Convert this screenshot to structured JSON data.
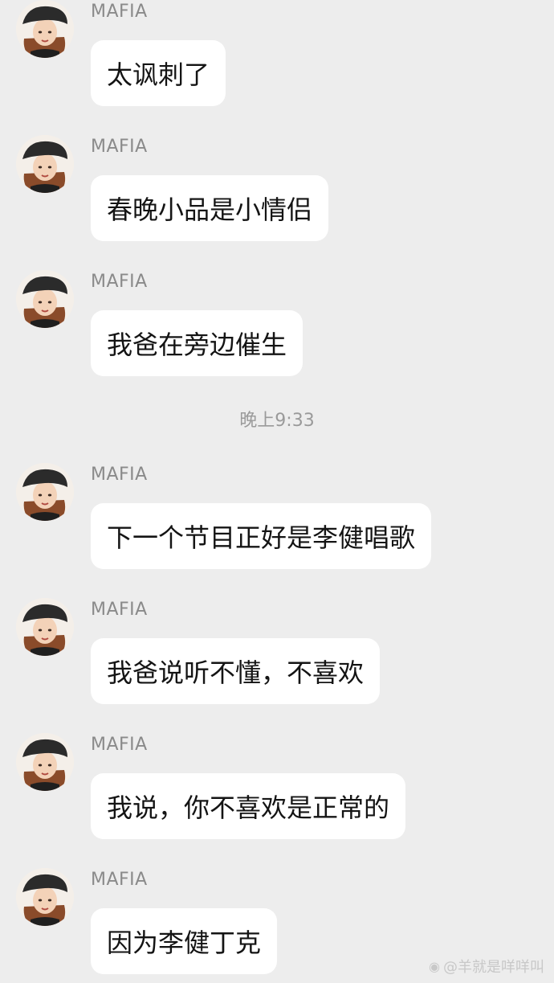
{
  "messages": [
    {
      "sender": "MAFIA",
      "text": "太讽刺了"
    },
    {
      "sender": "MAFIA",
      "text": "春晚小品是小情侣"
    },
    {
      "sender": "MAFIA",
      "text": "我爸在旁边催生"
    },
    {
      "sender": "MAFIA",
      "text": "下一个节目正好是李健唱歌"
    },
    {
      "sender": "MAFIA",
      "text": "我爸说听不懂，不喜欢"
    },
    {
      "sender": "MAFIA",
      "text": "我说，你不喜欢是正常的"
    },
    {
      "sender": "MAFIA",
      "text": "因为李健丁克"
    }
  ],
  "timestamp": "晚上9:33",
  "watermark": "@羊就是咩咩叫",
  "avatar_icon": "avatar-icon",
  "colors": {
    "background": "#ededed",
    "bubble": "#ffffff",
    "sender": "#8a8a8a",
    "text": "#141414"
  }
}
